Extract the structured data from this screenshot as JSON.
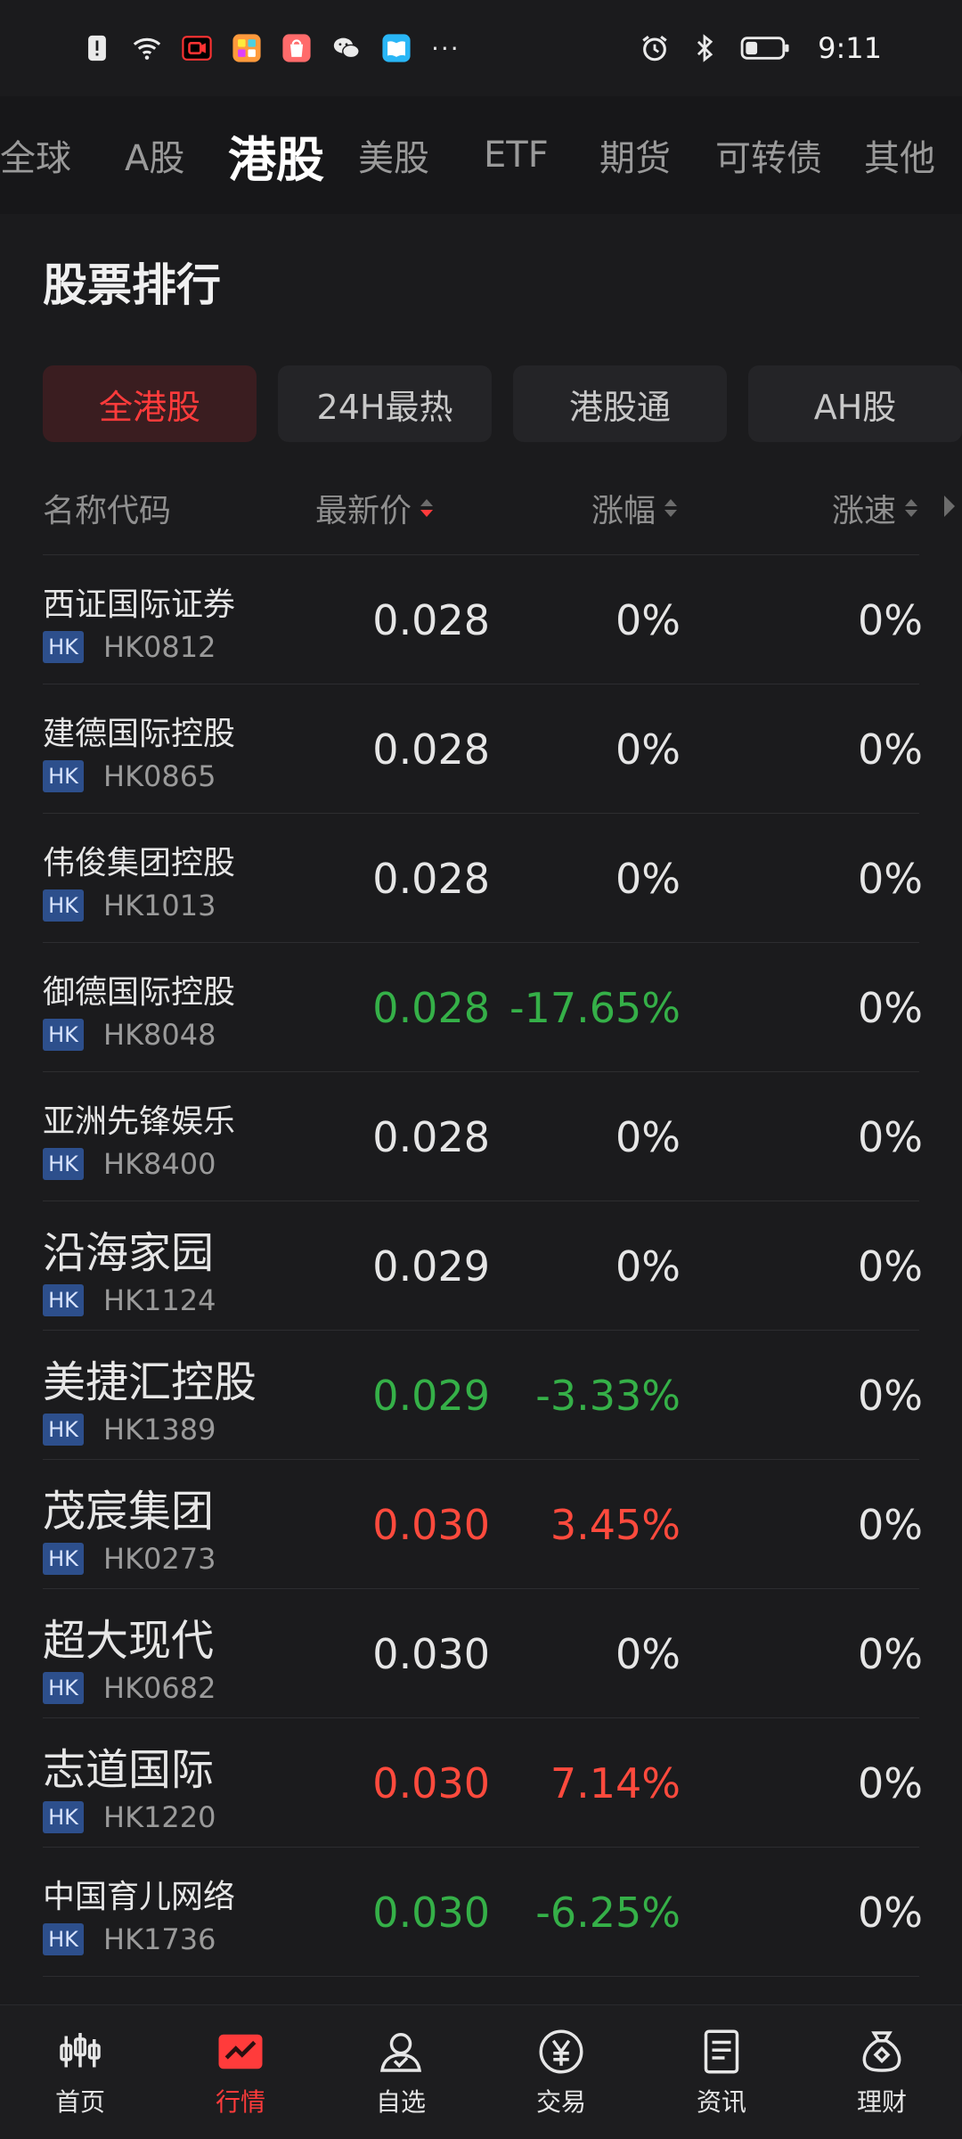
{
  "status_bar": {
    "time": "9:11",
    "dots": "···"
  },
  "market_tabs": [
    {
      "label": "全球"
    },
    {
      "label": "A股"
    },
    {
      "label": "港股"
    },
    {
      "label": "美股"
    },
    {
      "label": "ETF"
    },
    {
      "label": "期货"
    },
    {
      "label": "可转债"
    },
    {
      "label": "其他"
    }
  ],
  "section": {
    "title": "股票排行",
    "filters": [
      {
        "label": "全港股"
      },
      {
        "label": "24H最热"
      },
      {
        "label": "港股通"
      },
      {
        "label": "AH股"
      }
    ]
  },
  "columns": {
    "name": "名称代码",
    "price": "最新价",
    "change": "涨幅",
    "speed": "涨速"
  },
  "badge": "HK",
  "rows": [
    {
      "name": "西证国际证券",
      "code": "HK0812",
      "price": "0.028",
      "change": "0%",
      "speed": "0%"
    },
    {
      "name": "建德国际控股",
      "code": "HK0865",
      "price": "0.028",
      "change": "0%",
      "speed": "0%"
    },
    {
      "name": "伟俊集团控股",
      "code": "HK1013",
      "price": "0.028",
      "change": "0%",
      "speed": "0%"
    },
    {
      "name": "御德国际控股",
      "code": "HK8048",
      "price": "0.028",
      "change": "-17.65%",
      "speed": "0%"
    },
    {
      "name": "亚洲先锋娱乐",
      "code": "HK8400",
      "price": "0.028",
      "change": "0%",
      "speed": "0%"
    },
    {
      "name": "沿海家园",
      "code": "HK1124",
      "price": "0.029",
      "change": "0%",
      "speed": "0%"
    },
    {
      "name": "美捷汇控股",
      "code": "HK1389",
      "price": "0.029",
      "change": "-3.33%",
      "speed": "0%"
    },
    {
      "name": "茂宸集团",
      "code": "HK0273",
      "price": "0.030",
      "change": "3.45%",
      "speed": "0%"
    },
    {
      "name": "超大现代",
      "code": "HK0682",
      "price": "0.030",
      "change": "0%",
      "speed": "0%"
    },
    {
      "name": "志道国际",
      "code": "HK1220",
      "price": "0.030",
      "change": "7.14%",
      "speed": "0%"
    },
    {
      "name": "中国育儿网络",
      "code": "HK1736",
      "price": "0.030",
      "change": "-6.25%",
      "speed": "0%"
    }
  ],
  "bottom_nav": [
    {
      "label": "首页"
    },
    {
      "label": "行情"
    },
    {
      "label": "自选"
    },
    {
      "label": "交易"
    },
    {
      "label": "资讯"
    },
    {
      "label": "理财"
    }
  ],
  "colors": {
    "accent": "#ff3b3b",
    "up": "#ff4a3d",
    "down": "#35b048",
    "badge": "#2d4f8c"
  }
}
